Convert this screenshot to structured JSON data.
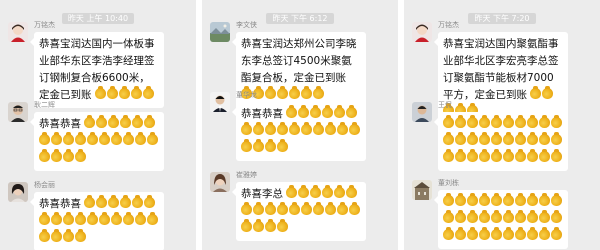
{
  "panels": [
    {
      "time": "昨天 上午 10:40",
      "messages": [
        {
          "name": "万铭杰",
          "text": "恭喜宝润达国内一体板事业部华东区李浩李经理签订钢制复合板6600米，定金已到账",
          "emoji_count": 5,
          "avatar": "woman-red-avatar"
        },
        {
          "name": "耿二辉",
          "text": "恭喜恭喜",
          "emoji_count": 20,
          "avatar": "man-glasses-avatar"
        },
        {
          "name": "杨会丽",
          "text": "恭喜恭喜",
          "emoji_count": 20,
          "avatar": "woman-dark-avatar"
        }
      ]
    },
    {
      "time": "昨天 下午 6:12",
      "messages": [
        {
          "name": "李文侠",
          "text": "恭喜宝润达郑州公司李晓东李总签订4500米聚氨酯复合板，定金已到账",
          "emoji_count": 7,
          "avatar": "landscape-avatar"
        },
        {
          "name": "董华龙",
          "text": "恭喜恭喜",
          "emoji_count": 20,
          "avatar": "man-suit-avatar"
        },
        {
          "name": "崔雅婷",
          "text": "恭喜李总",
          "emoji_count": 20,
          "avatar": "woman-brown-avatar"
        }
      ]
    },
    {
      "time": "昨天 下午 7:20",
      "messages": [
        {
          "name": "万铭杰",
          "text": "恭喜宝润达国内聚氨酯事业部华北区李宏亮李总签订聚氨酯节能板材7000平方，定金已到账",
          "emoji_count": 5,
          "avatar": "woman-red-avatar"
        },
        {
          "name": "王侃",
          "text": "",
          "emoji_count": 30,
          "avatar": "man-casual-avatar"
        },
        {
          "name": "董刘栋",
          "text": "",
          "emoji_count": 30,
          "avatar": "building-avatar"
        }
      ]
    }
  ]
}
